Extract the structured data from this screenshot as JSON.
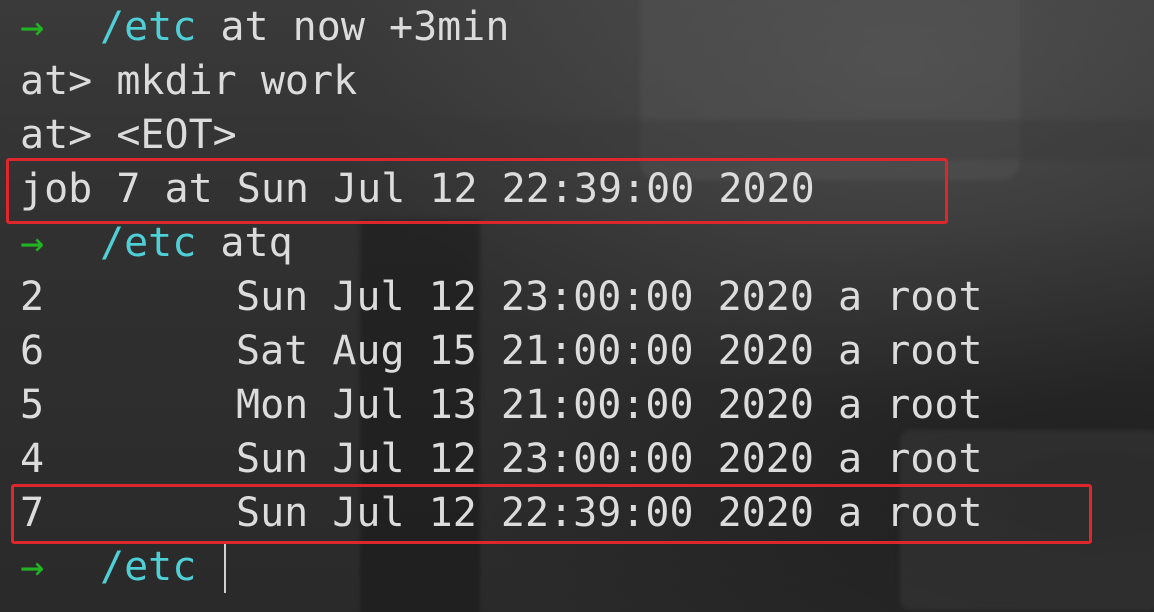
{
  "terminal": {
    "lines": {
      "l1": {
        "arrow": "→",
        "cwd": "/etc",
        "cmd": "at now +3min"
      },
      "l2": {
        "text": "at> mkdir work"
      },
      "l3": {
        "text": "at> <EOT>"
      },
      "l4": {
        "text": "job 7 at Sun Jul 12 22:39:00 2020"
      },
      "l5": {
        "arrow": "→",
        "cwd": "/etc",
        "cmd": "atq"
      }
    },
    "queue": [
      {
        "id": "2",
        "info": "Sun Jul 12 23:00:00 2020 a root"
      },
      {
        "id": "6",
        "info": "Sat Aug 15 21:00:00 2020 a root"
      },
      {
        "id": "5",
        "info": "Mon Jul 13 21:00:00 2020 a root"
      },
      {
        "id": "4",
        "info": "Sun Jul 12 23:00:00 2020 a root"
      },
      {
        "id": "7",
        "info": "Sun Jul 12 22:39:00 2020 a root"
      }
    ],
    "prompt_last": {
      "arrow": "→",
      "cwd": "/etc"
    }
  },
  "colors": {
    "arrow": "#22b322",
    "cwd": "#4fd0d6",
    "text": "#dcdcdc",
    "highlight": "#e0262d"
  }
}
